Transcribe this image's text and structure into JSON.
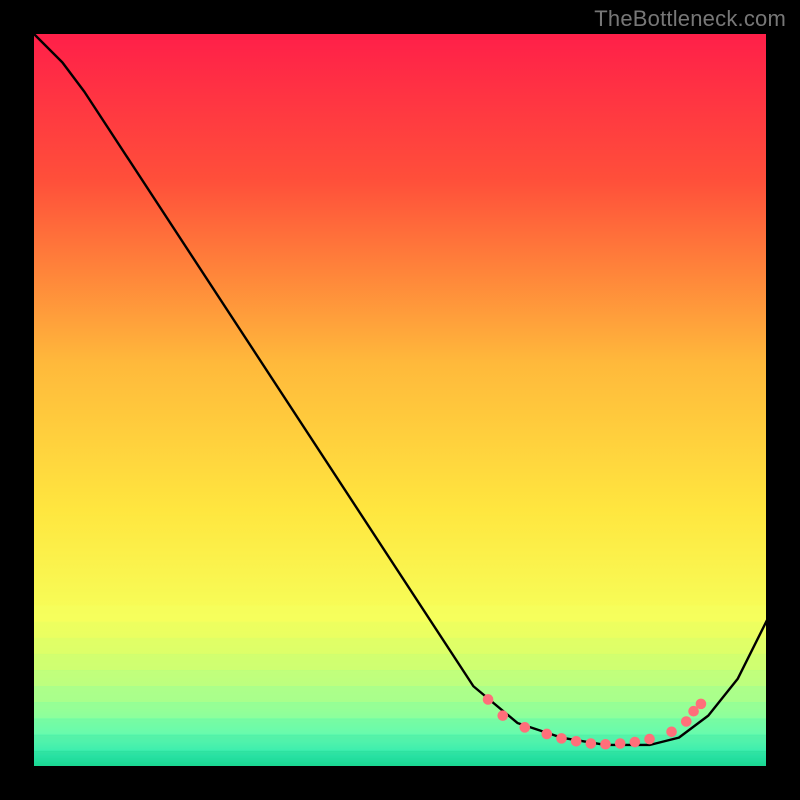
{
  "attribution": "TheBottleneck.com",
  "chart_data": {
    "type": "line",
    "title": "",
    "xlabel": "",
    "ylabel": "",
    "xlim": [
      0,
      100
    ],
    "ylim": [
      0,
      100
    ],
    "background_gradient": {
      "stops": [
        {
          "offset": 0.0,
          "color": "#ff1f49"
        },
        {
          "offset": 0.2,
          "color": "#ff4f3a"
        },
        {
          "offset": 0.45,
          "color": "#ffb93b"
        },
        {
          "offset": 0.65,
          "color": "#ffe63f"
        },
        {
          "offset": 0.8,
          "color": "#f6ff5a"
        },
        {
          "offset": 0.92,
          "color": "#c9ff7a"
        },
        {
          "offset": 0.965,
          "color": "#7bffb0"
        },
        {
          "offset": 0.985,
          "color": "#38f2b8"
        },
        {
          "offset": 1.0,
          "color": "#15d98f"
        }
      ]
    },
    "series": [
      {
        "name": "bottleneck-curve",
        "x": [
          0,
          4,
          7,
          60,
          66,
          72,
          78,
          84,
          88,
          92,
          96,
          100
        ],
        "y": [
          100,
          96,
          92,
          11,
          6,
          4,
          3,
          3,
          4,
          7,
          12,
          20
        ]
      }
    ],
    "markers": {
      "name": "highlight-points",
      "color": "#ff6f7a",
      "radius": 5.3,
      "x": [
        62,
        64,
        67,
        70,
        72,
        74,
        76,
        78,
        80,
        82,
        84,
        87,
        89,
        90,
        91
      ],
      "y": [
        9.2,
        7.0,
        5.4,
        4.5,
        3.9,
        3.5,
        3.2,
        3.1,
        3.2,
        3.4,
        3.8,
        4.8,
        6.2,
        7.6,
        8.6
      ]
    }
  }
}
